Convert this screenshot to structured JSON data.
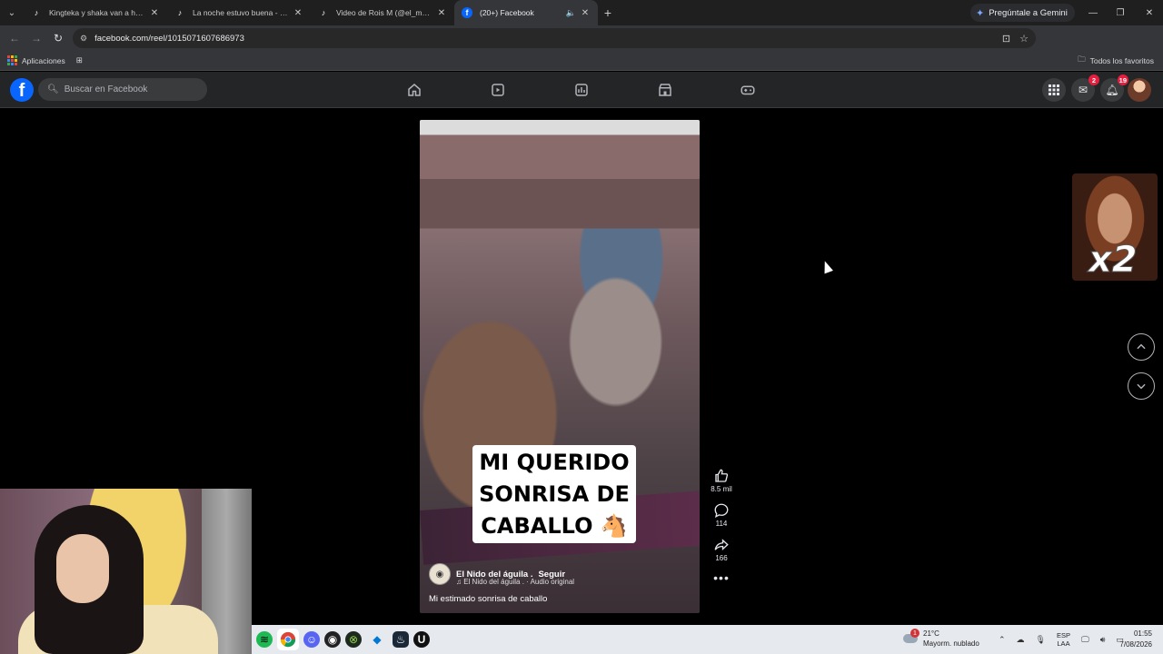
{
  "browser": {
    "tabs": [
      {
        "title": "Kingteka y shaka van a hospital",
        "icon": "tiktok-icon",
        "active": false
      },
      {
        "title": "La noche estuvo buena - sketch",
        "icon": "tiktok-icon",
        "active": false
      },
      {
        "title": "Video de Rois M (@el_masqsue",
        "icon": "tiktok-icon",
        "active": false
      },
      {
        "title": "(20+) Facebook",
        "icon": "facebook-icon",
        "active": true
      }
    ],
    "gemini_label": "Pregúntale a Gemini",
    "url": "facebook.com/reel/1015071607686973",
    "bookmarks": {
      "apps_label": "Aplicaciones",
      "favorites_label": "Todos los favoritos"
    }
  },
  "facebook": {
    "search_placeholder": "Buscar en Facebook",
    "messenger_badge": "2",
    "notifications_badge": "19",
    "accent": "#0866ff"
  },
  "reel": {
    "overlay_text_line1": "MI QUERIDO",
    "overlay_text_line2": "SONRISA DE",
    "overlay_text_line3": "CABALLO 🐴",
    "author": "El Nido del águila .",
    "follow_label": "Seguir",
    "audio": "♫ El Nido del águila . · Audio original",
    "description": "Mi estimado sonrisa de caballo",
    "likes": "8.5 mil",
    "comments": "114",
    "shares": "166"
  },
  "sticker": {
    "text": "x2"
  },
  "taskbar": {
    "temperature": "21°C",
    "weather": "Mayorm. nublado",
    "weather_alert": "1",
    "lang_line1": "ESP",
    "lang_line2": "LAA",
    "time": "01:55",
    "date": "7/08/2026"
  }
}
